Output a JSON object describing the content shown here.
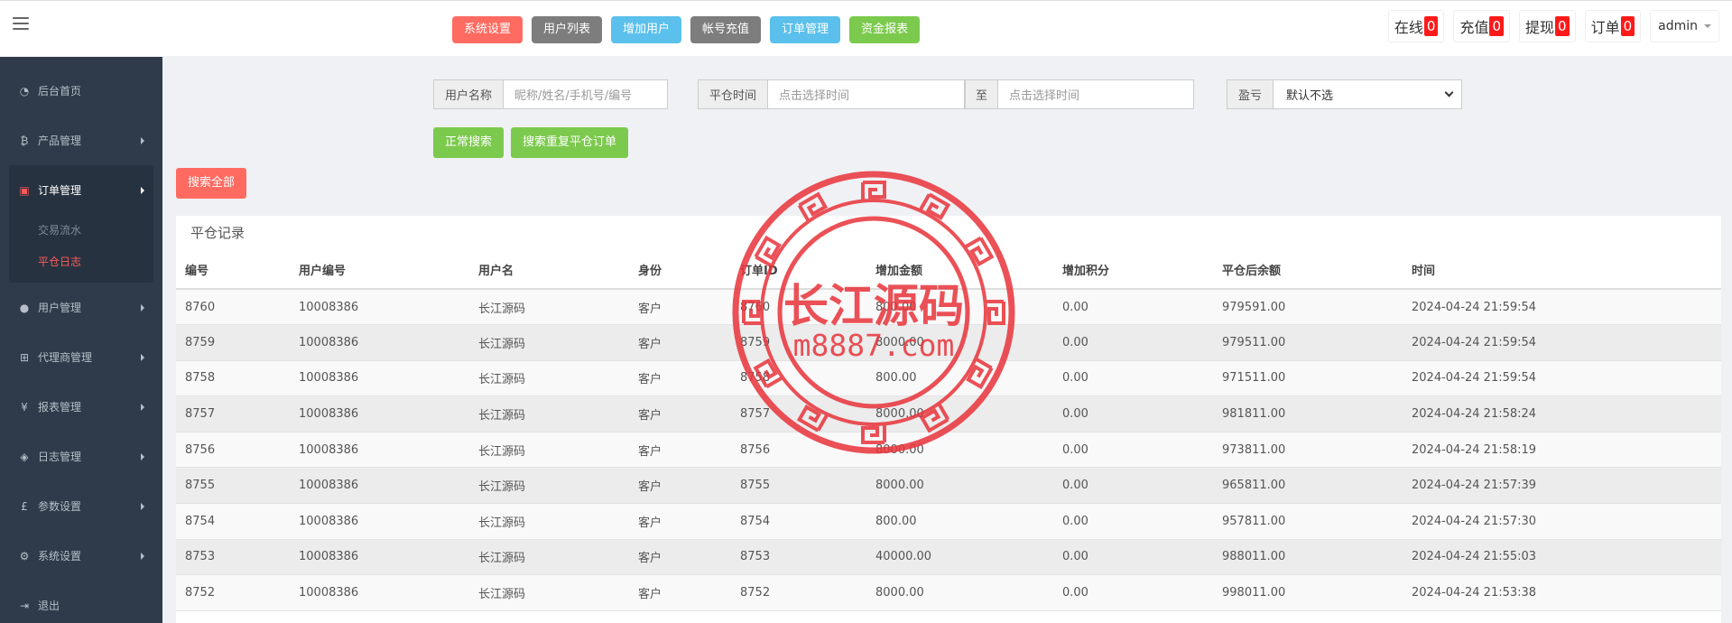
{
  "topbar": {
    "buttons": [
      {
        "label": "系统设置",
        "color": "#ff6b61"
      },
      {
        "label": "用户列表",
        "color": "#7d7d7d"
      },
      {
        "label": "增加用户",
        "color": "#5bc0eb"
      },
      {
        "label": "帐号充值",
        "color": "#7d7d7d"
      },
      {
        "label": "订单管理",
        "color": "#5bc0eb"
      },
      {
        "label": "资金报表",
        "color": "#7cca4d"
      }
    ],
    "stats": [
      {
        "label": "在线",
        "count": "0"
      },
      {
        "label": "充值",
        "count": "0"
      },
      {
        "label": "提现",
        "count": "0"
      },
      {
        "label": "订单",
        "count": "0"
      }
    ],
    "user": "admin"
  },
  "sidebar": {
    "items": [
      {
        "label": "后台首页",
        "icon": "dashboard-icon"
      },
      {
        "label": "产品管理",
        "icon": "bitcoin-icon"
      },
      {
        "label": "订单管理",
        "icon": "files-icon"
      },
      {
        "label": "用户管理",
        "icon": "user-icon"
      },
      {
        "label": "代理商管理",
        "icon": "sitemap-icon"
      },
      {
        "label": "报表管理",
        "icon": "yen-icon"
      },
      {
        "label": "日志管理",
        "icon": "tag-icon"
      },
      {
        "label": "参数设置",
        "icon": "pound-icon"
      },
      {
        "label": "系统设置",
        "icon": "gears-icon"
      },
      {
        "label": "退出",
        "icon": "sign-out-icon"
      }
    ],
    "sub_items": [
      "交易流水",
      "平仓日志"
    ]
  },
  "filters": {
    "username_label": "用户名称",
    "username_placeholder": "昵称/姓名/手机号/编号",
    "time_label": "平仓时间",
    "time_from_placeholder": "点击选择时间",
    "to_label": "至",
    "time_to_placeholder": "点击选择时间",
    "profit_label": "盈亏",
    "profit_value": "默认不选"
  },
  "actions": {
    "normal_search": "正常搜索",
    "dup_search": "搜索重复平仓订单",
    "search_all": "搜索全部"
  },
  "table": {
    "title": "平仓记录",
    "headers": [
      "编号",
      "用户编号",
      "用户名",
      "身份",
      "订单ID",
      "增加金额",
      "增加积分",
      "平仓后余额",
      "时间"
    ],
    "rows": [
      [
        "8760",
        "10008386",
        "长江源码",
        "客户",
        "8760",
        "800.00",
        "0.00",
        "979591.00",
        "2024-04-24 21:59:54"
      ],
      [
        "8759",
        "10008386",
        "长江源码",
        "客户",
        "8759",
        "8000.00",
        "0.00",
        "979511.00",
        "2024-04-24 21:59:54"
      ],
      [
        "8758",
        "10008386",
        "长江源码",
        "客户",
        "8758",
        "800.00",
        "0.00",
        "971511.00",
        "2024-04-24 21:59:54"
      ],
      [
        "8757",
        "10008386",
        "长江源码",
        "客户",
        "8757",
        "8000.00",
        "0.00",
        "981811.00",
        "2024-04-24 21:58:24"
      ],
      [
        "8756",
        "10008386",
        "长江源码",
        "客户",
        "8756",
        "8000.00",
        "0.00",
        "973811.00",
        "2024-04-24 21:58:19"
      ],
      [
        "8755",
        "10008386",
        "长江源码",
        "客户",
        "8755",
        "8000.00",
        "0.00",
        "965811.00",
        "2024-04-24 21:57:39"
      ],
      [
        "8754",
        "10008386",
        "长江源码",
        "客户",
        "8754",
        "800.00",
        "0.00",
        "957811.00",
        "2024-04-24 21:57:30"
      ],
      [
        "8753",
        "10008386",
        "长江源码",
        "客户",
        "8753",
        "40000.00",
        "0.00",
        "988011.00",
        "2024-04-24 21:55:03"
      ],
      [
        "8752",
        "10008386",
        "长江源码",
        "客户",
        "8752",
        "8000.00",
        "0.00",
        "998011.00",
        "2024-04-24 21:53:38"
      ]
    ]
  },
  "watermark": {
    "line1": "长江源码",
    "line2": "m8887.com",
    "color": "#e8333a"
  }
}
